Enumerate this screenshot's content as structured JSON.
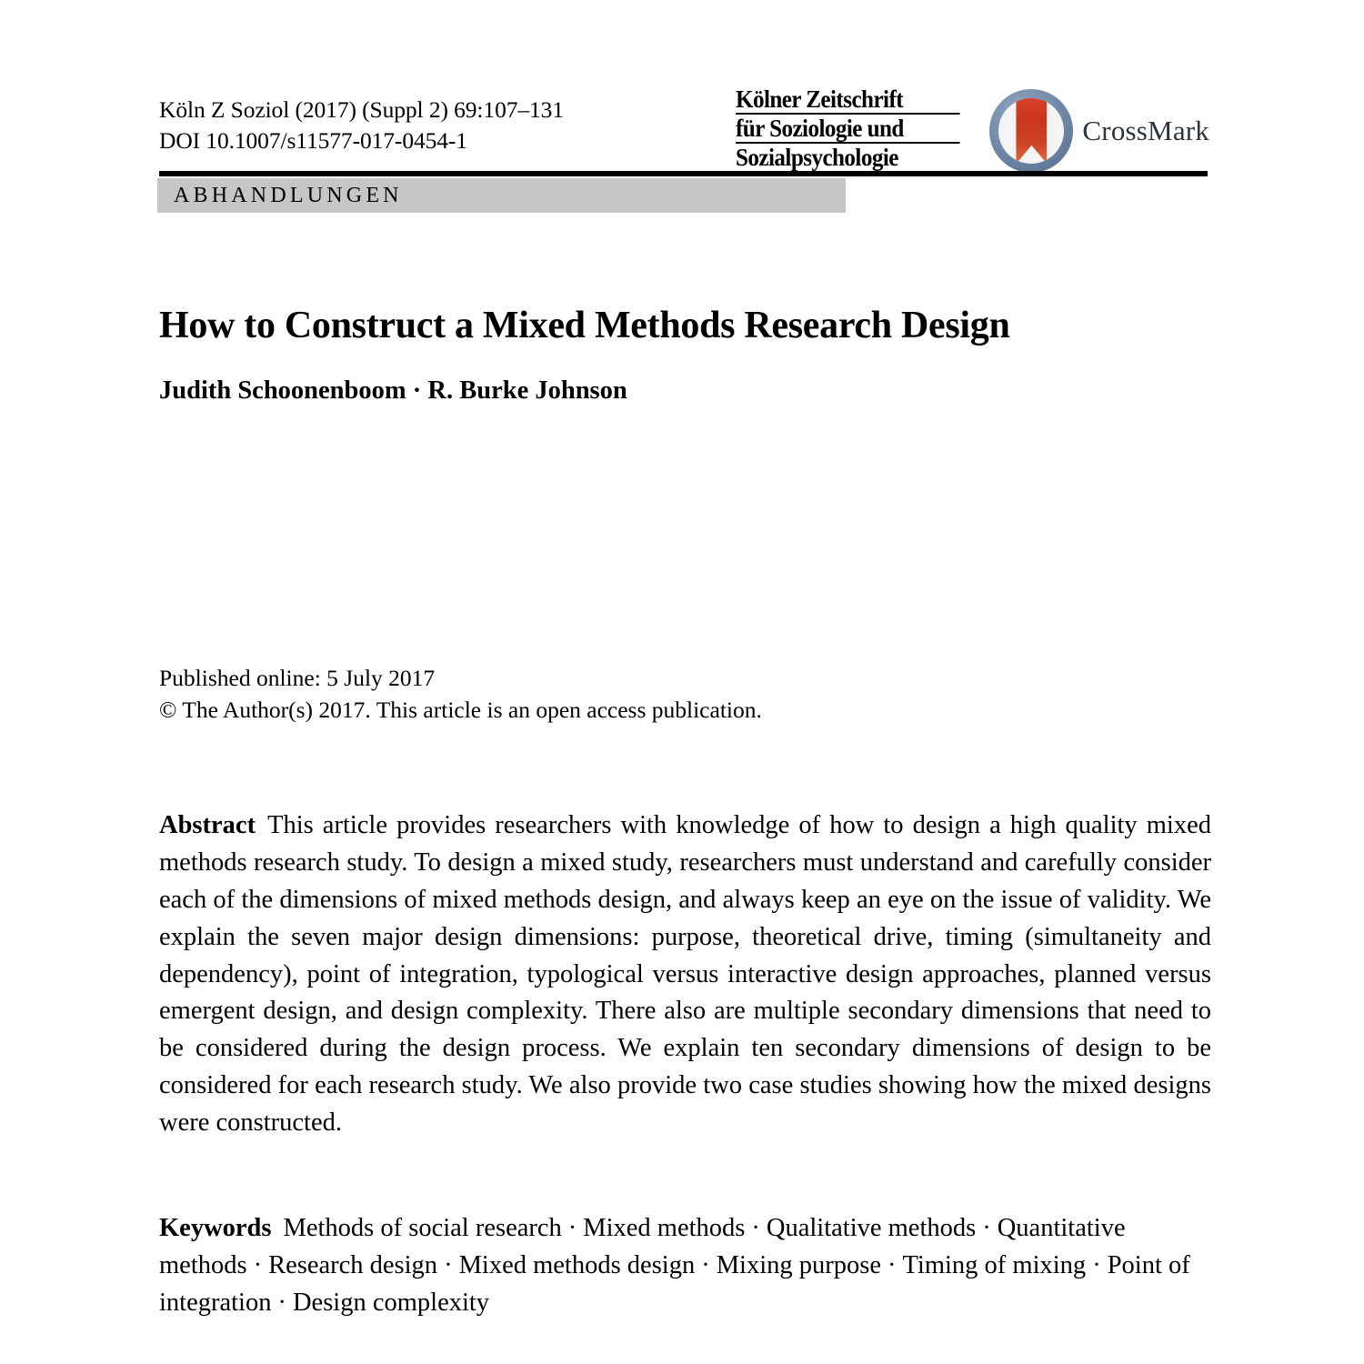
{
  "header": {
    "citation_line1": "Köln Z Soziol (2017) (Suppl 2) 69:107–131",
    "citation_line2": "DOI 10.1007/s11577-017-0454-1",
    "journal_logo": {
      "line1": "Kölner Zeitschrift",
      "line2": "für Soziologie und",
      "line3": "Sozialpsychologie"
    },
    "crossmark_label": "CrossMark",
    "section_label": "ABHANDLUNGEN"
  },
  "article": {
    "title": "How to Construct a Mixed Methods Research Design",
    "authors": "Judith Schoonenboom · R. Burke Johnson",
    "published_online": "Published online: 5 July 2017",
    "copyright": "© The Author(s) 2017. This article is an open access publication."
  },
  "abstract": {
    "lead": "Abstract",
    "text": "This article provides researchers with knowledge of how to design a high quality mixed methods research study. To design a mixed study, researchers must understand and carefully consider each of the dimensions of mixed methods design, and always keep an eye on the issue of validity. We explain the seven major design dimensions: purpose, theoretical drive, timing (simultaneity and dependency), point of integration, typological versus interactive design approaches, planned versus emergent design, and design complexity. There also are multiple secondary dimensions that need to be considered during the design process. We explain ten secondary dimensions of design to be considered for each research study. We also provide two case studies showing how the mixed designs were constructed."
  },
  "keywords": {
    "lead": "Keywords",
    "items": [
      "Methods of social research",
      "Mixed methods",
      "Qualitative methods",
      "Quantitative methods",
      "Research design",
      "Mixed methods design",
      "Mixing purpose",
      "Timing of mixing",
      "Point of integration",
      "Design complexity"
    ],
    "separator": "·"
  },
  "colors": {
    "section_bar_gray": "#c6c6c6",
    "rule_black": "#000000",
    "crossmark_ring": "#7189a8",
    "crossmark_ribbon": "#c8351f",
    "crossmark_text": "#2b3340"
  }
}
